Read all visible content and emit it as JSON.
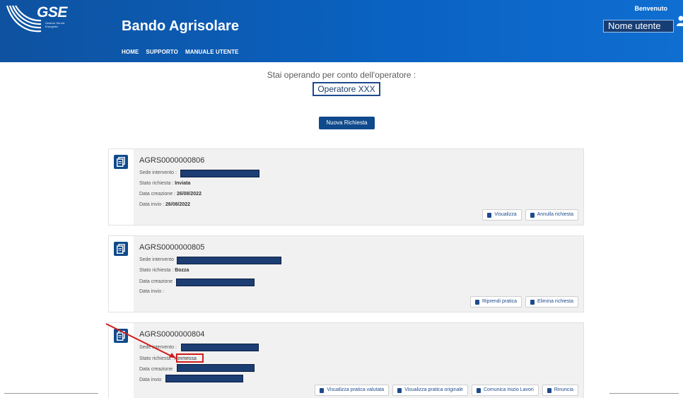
{
  "header": {
    "logo_text": "GSE",
    "logo_sub": "Gestore Servizi Energetici",
    "title": "Bando Agrisolare",
    "nav": [
      "HOME",
      "SUPPORTO",
      "MANUALE UTENTE"
    ],
    "welcome": "Benvenuto",
    "user_name": "Nome utente"
  },
  "operator": {
    "label": "Stai operando per conto dell'operatore :",
    "name": "Operatore XXX"
  },
  "new_request_label": "Nuova Richiesta",
  "cards": [
    {
      "code": "AGRS0000000806",
      "sede_label": "Sede intervento :",
      "stato_label": "Stato richiesta :",
      "stato_value": "Inviata",
      "data_creazione_label": "Data creazione :",
      "data_creazione_value": "26/08/2022",
      "data_invio_label": "Data invio :",
      "data_invio_value": "26/08/2022",
      "actions": [
        "Visualizza",
        "Annulla richiesta"
      ]
    },
    {
      "code": "AGRS0000000805",
      "sede_label": "Sede intervento",
      "stato_label": "Stato richiesta :",
      "stato_value": "Bozza",
      "data_creazione_label": "Data creazione",
      "data_invio_label": "Data invio :",
      "actions": [
        "Riprendi pratica",
        "Elimina richiesta"
      ]
    },
    {
      "code": "AGRS0000000804",
      "sede_label": "Sede intervento :",
      "stato_label": "Stato richiesta :",
      "stato_value": "Ammessa",
      "data_creazione_label": "Data creazione",
      "data_invio_label": "Data invio",
      "actions": [
        "Visualizza pratica valutata",
        "Visualizza pratica originale",
        "Comunica Inizio Lavori",
        "Rinuncia"
      ]
    }
  ],
  "colors": {
    "header_blue": "#0a63c4",
    "primary": "#0f4a8c",
    "redaction": "#1c3e72",
    "annotation_red": "#d11c1c"
  }
}
